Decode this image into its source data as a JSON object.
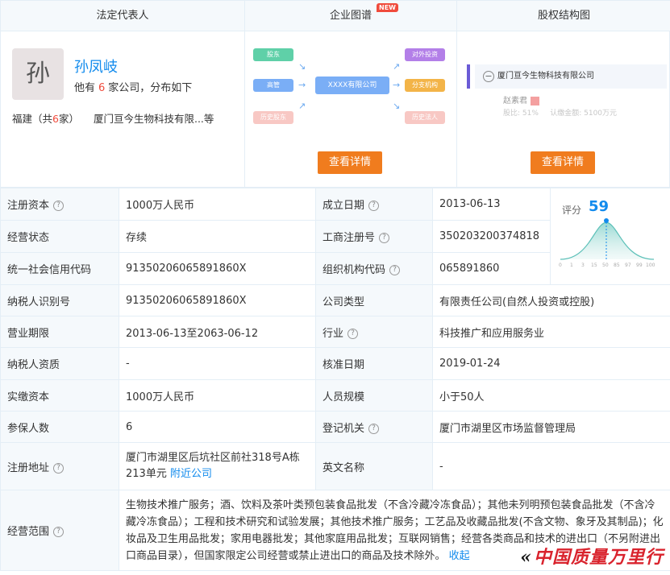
{
  "panels": {
    "legal": {
      "title": "法定代表人",
      "avatar_char": "孙",
      "name": "孙凤岐",
      "sub_prefix": "他有",
      "company_count": "6",
      "sub_suffix": "家公司，分布如下",
      "region_prefix": "福建（共",
      "region_count": "6",
      "region_suffix": "家）",
      "region_company": "厦门亘今生物科技有限...等"
    },
    "graph": {
      "title": "企业图谱",
      "badge": "NEW",
      "left_nodes": [
        "股东",
        "高管",
        "历史股东"
      ],
      "center_node": "XXXX有限公司",
      "right_nodes": [
        "对外投资",
        "分支机构",
        "历史法人"
      ],
      "button": "查看详情"
    },
    "equity": {
      "title": "股权结构图",
      "company": "厦门亘今生物科技有限公司",
      "holder": "赵素君",
      "holder_ratio": "股比: 51%",
      "holder_amount": "认缴金额: 5100万元",
      "button": "查看详情"
    }
  },
  "info": {
    "rows": [
      {
        "l1": "注册资本",
        "v1": "1000万人民币",
        "l2": "成立日期",
        "v2": "2013-06-13"
      },
      {
        "l1": "经营状态",
        "v1": "存续",
        "l2": "工商注册号",
        "v2": "350203200374818"
      },
      {
        "l1": "统一社会信用代码",
        "v1": "91350206065891860X",
        "l2": "组织机构代码",
        "v2": "065891860"
      },
      {
        "l1": "纳税人识别号",
        "v1": "91350206065891860X",
        "l2": "公司类型",
        "v2": "有限责任公司(自然人投资或控股)"
      },
      {
        "l1": "营业期限",
        "v1": "2013-06-13至2063-06-12",
        "l2": "行业",
        "v2": "科技推广和应用服务业"
      },
      {
        "l1": "纳税人资质",
        "v1": "-",
        "l2": "核准日期",
        "v2": "2019-01-24"
      },
      {
        "l1": "实缴资本",
        "v1": "1000万人民币",
        "l2": "人员规模",
        "v2": "小于50人"
      },
      {
        "l1": "参保人数",
        "v1": "6",
        "l2": "登记机关",
        "v2": "厦门市湖里区市场监督管理局"
      }
    ],
    "address_label": "注册地址",
    "address_value": "厦门市湖里区后坑社区前社318号A栋213单元",
    "address_link": "附近公司",
    "english_label": "英文名称",
    "english_value": "-",
    "scope_label": "经营范围",
    "scope_value": "生物技术推广服务；酒、饮料及茶叶类预包装食品批发（不含冷藏冷冻食品）；其他未列明预包装食品批发（不含冷藏冷冻食品）；工程和技术研究和试验发展；其他技术推广服务；工艺品及收藏品批发(不含文物、象牙及其制品)；化妆品及卫生用品批发；家用电器批发；其他家庭用品批发；互联网销售；经营各类商品和技术的进出口（不另附进出口商品目录），但国家限定公司经营或禁止进出口的商品及技术除外。",
    "scope_link": "收起",
    "score_label": "评分",
    "score_value": "59",
    "score_ticks": [
      "0",
      "1",
      "3",
      "15",
      "50",
      "85",
      "97",
      "99",
      "100"
    ]
  },
  "watermark": "中国质量万里行"
}
